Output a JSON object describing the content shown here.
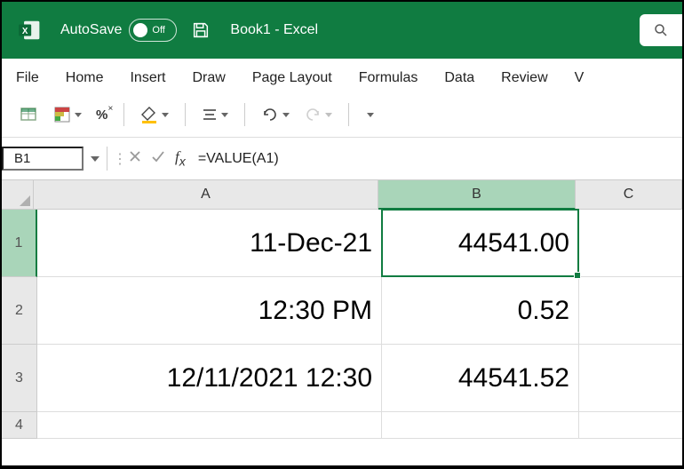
{
  "titlebar": {
    "autosave_label": "AutoSave",
    "toggle_state": "Off",
    "doc_title": "Book1  -  Excel"
  },
  "ribbon": {
    "tabs": [
      "File",
      "Home",
      "Insert",
      "Draw",
      "Page Layout",
      "Formulas",
      "Data",
      "Review",
      "V"
    ]
  },
  "name_box": "B1",
  "formula": "=VALUE(A1)",
  "col_headers": {
    "A": "A",
    "B": "B",
    "C": "C"
  },
  "row_headers": {
    "r1": "1",
    "r2": "2",
    "r3": "3",
    "r4": "4"
  },
  "cells": {
    "A1": "11-Dec-21",
    "B1": "44541.00",
    "A2": "12:30 PM",
    "B2": "0.52",
    "A3": "12/11/2021 12:30",
    "B3": "44541.52"
  },
  "layout": {
    "col_widths": {
      "A": 388,
      "B": 222,
      "C": 120
    },
    "row_heights": {
      "r1": 76,
      "r2": 76,
      "r3": 76,
      "r4": 30
    }
  }
}
